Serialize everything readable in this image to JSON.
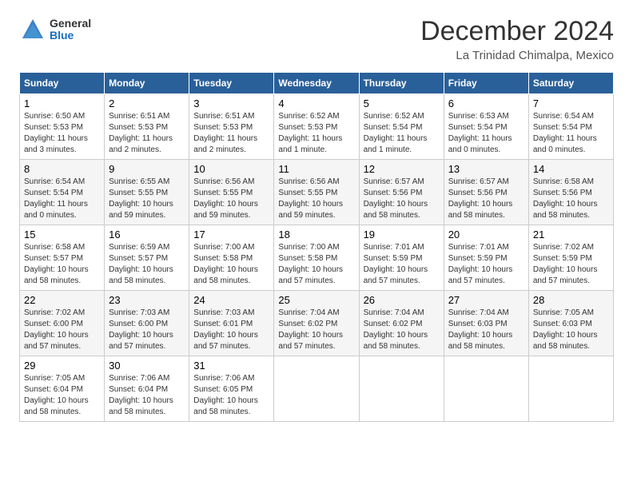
{
  "logo": {
    "text_general": "General",
    "text_blue": "Blue"
  },
  "header": {
    "title": "December 2024",
    "location": "La Trinidad Chimalpa, Mexico"
  },
  "weekdays": [
    "Sunday",
    "Monday",
    "Tuesday",
    "Wednesday",
    "Thursday",
    "Friday",
    "Saturday"
  ],
  "weeks": [
    [
      {
        "day": "1",
        "detail": "Sunrise: 6:50 AM\nSunset: 5:53 PM\nDaylight: 11 hours\nand 3 minutes."
      },
      {
        "day": "2",
        "detail": "Sunrise: 6:51 AM\nSunset: 5:53 PM\nDaylight: 11 hours\nand 2 minutes."
      },
      {
        "day": "3",
        "detail": "Sunrise: 6:51 AM\nSunset: 5:53 PM\nDaylight: 11 hours\nand 2 minutes."
      },
      {
        "day": "4",
        "detail": "Sunrise: 6:52 AM\nSunset: 5:53 PM\nDaylight: 11 hours\nand 1 minute."
      },
      {
        "day": "5",
        "detail": "Sunrise: 6:52 AM\nSunset: 5:54 PM\nDaylight: 11 hours\nand 1 minute."
      },
      {
        "day": "6",
        "detail": "Sunrise: 6:53 AM\nSunset: 5:54 PM\nDaylight: 11 hours\nand 0 minutes."
      },
      {
        "day": "7",
        "detail": "Sunrise: 6:54 AM\nSunset: 5:54 PM\nDaylight: 11 hours\nand 0 minutes."
      }
    ],
    [
      {
        "day": "8",
        "detail": "Sunrise: 6:54 AM\nSunset: 5:54 PM\nDaylight: 11 hours\nand 0 minutes."
      },
      {
        "day": "9",
        "detail": "Sunrise: 6:55 AM\nSunset: 5:55 PM\nDaylight: 10 hours\nand 59 minutes."
      },
      {
        "day": "10",
        "detail": "Sunrise: 6:56 AM\nSunset: 5:55 PM\nDaylight: 10 hours\nand 59 minutes."
      },
      {
        "day": "11",
        "detail": "Sunrise: 6:56 AM\nSunset: 5:55 PM\nDaylight: 10 hours\nand 59 minutes."
      },
      {
        "day": "12",
        "detail": "Sunrise: 6:57 AM\nSunset: 5:56 PM\nDaylight: 10 hours\nand 58 minutes."
      },
      {
        "day": "13",
        "detail": "Sunrise: 6:57 AM\nSunset: 5:56 PM\nDaylight: 10 hours\nand 58 minutes."
      },
      {
        "day": "14",
        "detail": "Sunrise: 6:58 AM\nSunset: 5:56 PM\nDaylight: 10 hours\nand 58 minutes."
      }
    ],
    [
      {
        "day": "15",
        "detail": "Sunrise: 6:58 AM\nSunset: 5:57 PM\nDaylight: 10 hours\nand 58 minutes."
      },
      {
        "day": "16",
        "detail": "Sunrise: 6:59 AM\nSunset: 5:57 PM\nDaylight: 10 hours\nand 58 minutes."
      },
      {
        "day": "17",
        "detail": "Sunrise: 7:00 AM\nSunset: 5:58 PM\nDaylight: 10 hours\nand 58 minutes."
      },
      {
        "day": "18",
        "detail": "Sunrise: 7:00 AM\nSunset: 5:58 PM\nDaylight: 10 hours\nand 57 minutes."
      },
      {
        "day": "19",
        "detail": "Sunrise: 7:01 AM\nSunset: 5:59 PM\nDaylight: 10 hours\nand 57 minutes."
      },
      {
        "day": "20",
        "detail": "Sunrise: 7:01 AM\nSunset: 5:59 PM\nDaylight: 10 hours\nand 57 minutes."
      },
      {
        "day": "21",
        "detail": "Sunrise: 7:02 AM\nSunset: 5:59 PM\nDaylight: 10 hours\nand 57 minutes."
      }
    ],
    [
      {
        "day": "22",
        "detail": "Sunrise: 7:02 AM\nSunset: 6:00 PM\nDaylight: 10 hours\nand 57 minutes."
      },
      {
        "day": "23",
        "detail": "Sunrise: 7:03 AM\nSunset: 6:00 PM\nDaylight: 10 hours\nand 57 minutes."
      },
      {
        "day": "24",
        "detail": "Sunrise: 7:03 AM\nSunset: 6:01 PM\nDaylight: 10 hours\nand 57 minutes."
      },
      {
        "day": "25",
        "detail": "Sunrise: 7:04 AM\nSunset: 6:02 PM\nDaylight: 10 hours\nand 57 minutes."
      },
      {
        "day": "26",
        "detail": "Sunrise: 7:04 AM\nSunset: 6:02 PM\nDaylight: 10 hours\nand 58 minutes."
      },
      {
        "day": "27",
        "detail": "Sunrise: 7:04 AM\nSunset: 6:03 PM\nDaylight: 10 hours\nand 58 minutes."
      },
      {
        "day": "28",
        "detail": "Sunrise: 7:05 AM\nSunset: 6:03 PM\nDaylight: 10 hours\nand 58 minutes."
      }
    ],
    [
      {
        "day": "29",
        "detail": "Sunrise: 7:05 AM\nSunset: 6:04 PM\nDaylight: 10 hours\nand 58 minutes."
      },
      {
        "day": "30",
        "detail": "Sunrise: 7:06 AM\nSunset: 6:04 PM\nDaylight: 10 hours\nand 58 minutes."
      },
      {
        "day": "31",
        "detail": "Sunrise: 7:06 AM\nSunset: 6:05 PM\nDaylight: 10 hours\nand 58 minutes."
      },
      {
        "day": "",
        "detail": ""
      },
      {
        "day": "",
        "detail": ""
      },
      {
        "day": "",
        "detail": ""
      },
      {
        "day": "",
        "detail": ""
      }
    ]
  ]
}
